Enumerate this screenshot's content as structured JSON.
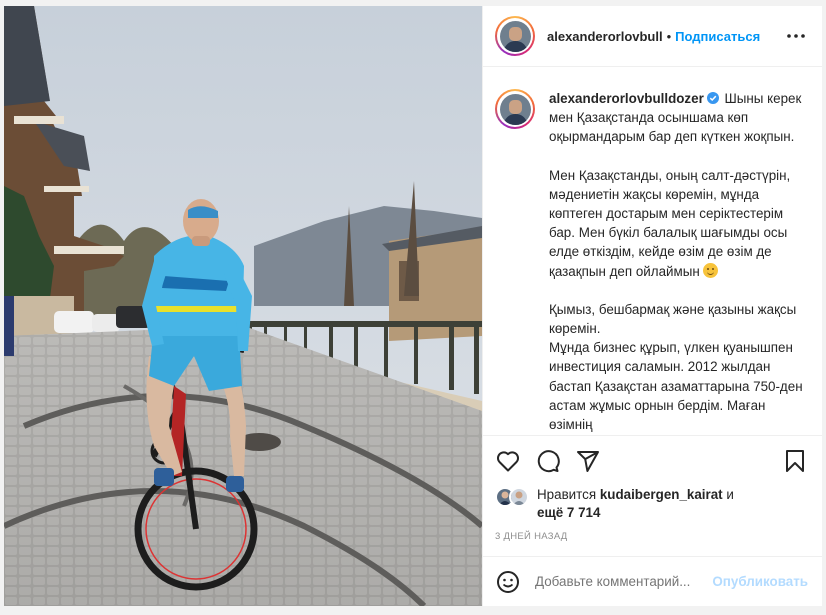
{
  "post": {
    "username": "alexanderorlovbull",
    "separator": "•",
    "follow_label": "Подписаться",
    "more_icon": "more-horizontal-icon"
  },
  "caption": {
    "author": "alexanderorlovbulldozer",
    "verified_icon": "verified-badge-icon",
    "paragraph1": "Шыны керек мен Қазақстанда осыншама көп оқырмандарым бар деп күткен жоқпын.",
    "paragraph2": "Мен Қазақстанды, оның салт-дәстүрін, мәдениетін жақсы көремін, мұнда көптеген достарым мен серіктестерім бар. Мен бүкіл балалық шағымды осы елде өткіздім, кейде өзім де өзім де қазақпын деп ойлаймын",
    "paragraph3a": "Қымыз, бешбармақ және қазыны жақсы көремін.",
    "paragraph3b": "Мұнда бизнес құрып, үлкен қуанышпен инвестиция саламын. 2012 жылдан бастап Қазақстан азаматтарына 750-ден астам жұмыс орнын бердім. Маған өзімнің",
    "emoji": "smiling-face-emoji"
  },
  "actions": {
    "like_icon": "heart-icon",
    "comment_icon": "comment-icon",
    "share_icon": "send-icon",
    "save_icon": "bookmark-icon"
  },
  "likes": {
    "prefix": "Нравится",
    "user": "kudaibergen_kairat",
    "conj": "и",
    "more": "ещё 7 714"
  },
  "timestamp": "3 ДНЕЙ НАЗАД",
  "comment": {
    "emoji_icon": "emoji-icon",
    "placeholder": "Добавьте комментарий...",
    "post_label": "Опубликовать"
  },
  "colors": {
    "accent": "#0095f6",
    "post_disabled": "#b3dbff",
    "text": "#262626",
    "muted": "#8e8e8e"
  }
}
